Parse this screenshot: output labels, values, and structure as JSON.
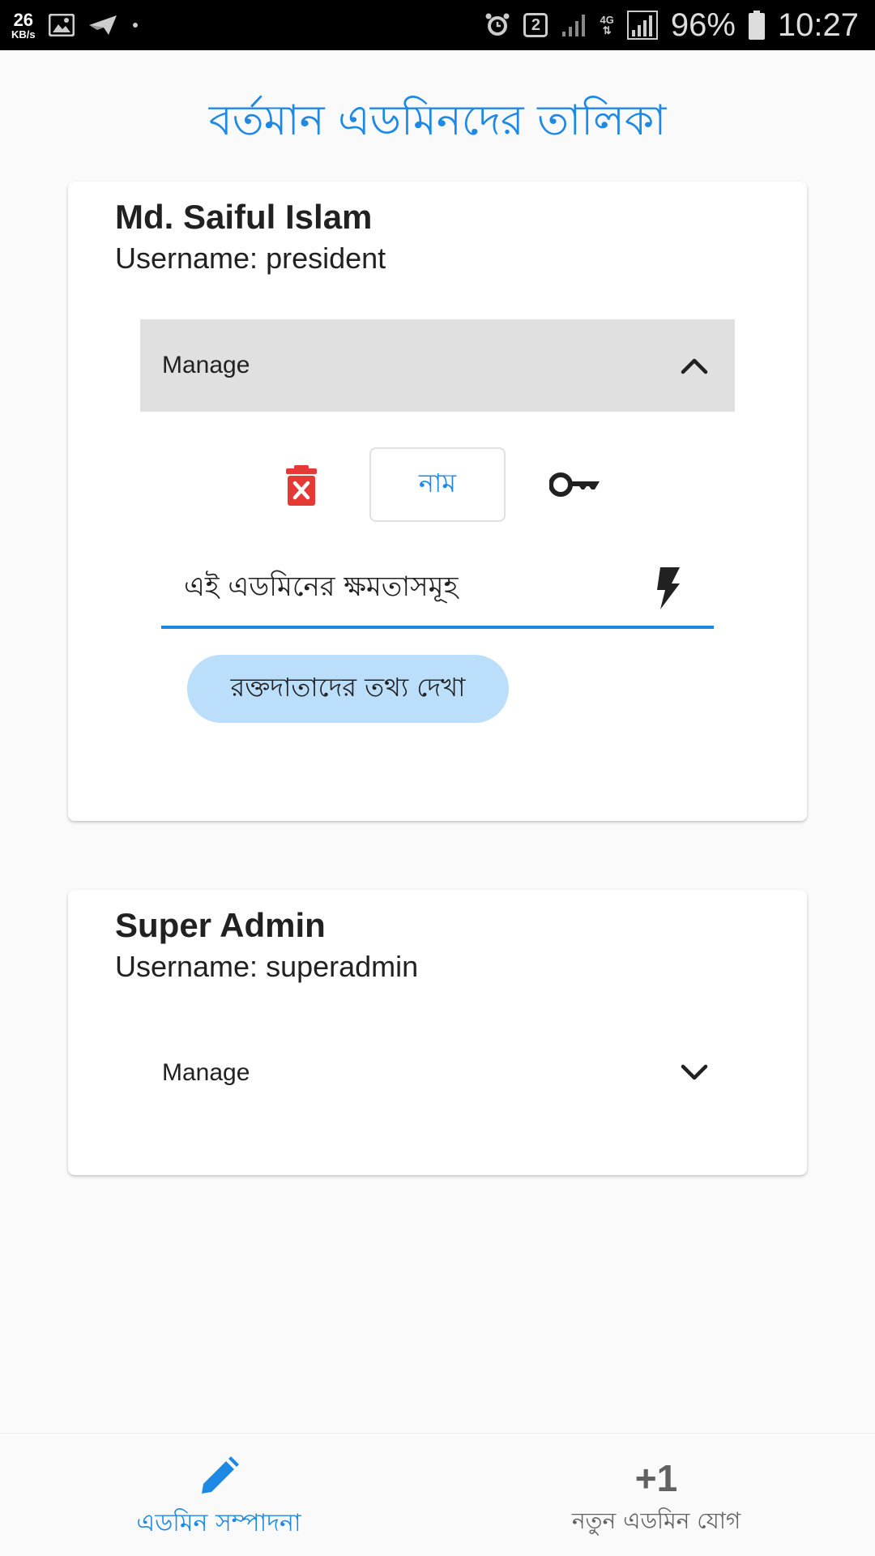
{
  "status_bar": {
    "net_speed_value": "26",
    "net_speed_unit": "KB/s",
    "sim_slot": "2",
    "network_type": "4G",
    "battery": "96%",
    "time": "10:27",
    "icons": [
      "image-icon",
      "send-icon",
      "dot-icon",
      "alarm-icon",
      "sim-icon",
      "signal-icon",
      "battery-icon"
    ]
  },
  "page": {
    "title": "বর্তমান এডমিনদের তালিকা"
  },
  "admins": [
    {
      "name": "Md. Saiful Islam",
      "username": "Username: president",
      "manage_label": "Manage",
      "expanded": true,
      "actions": {
        "delete_icon": "delete-icon",
        "name_button": "নাম",
        "key_icon": "key-icon"
      },
      "permissions_label": "এই এডমিনের ক্ষমতাসমূহ",
      "permission_chips": [
        "রক্তদাতাদের তথ্য দেখা"
      ]
    },
    {
      "name": "Super Admin",
      "username": "Username: superadmin",
      "manage_label": "Manage",
      "expanded": false
    }
  ],
  "bottom_nav": {
    "items": [
      {
        "label": "এডমিন সম্পাদনা",
        "icon": "pencil-icon",
        "active": true
      },
      {
        "label": "নতুন এডমিন যোগ",
        "icon_text": "+1",
        "active": false
      }
    ]
  },
  "colors": {
    "accent": "#1e88e5",
    "delete": "#e53935",
    "chip": "#bbdefb",
    "manage_bg": "#e0e0e0"
  }
}
